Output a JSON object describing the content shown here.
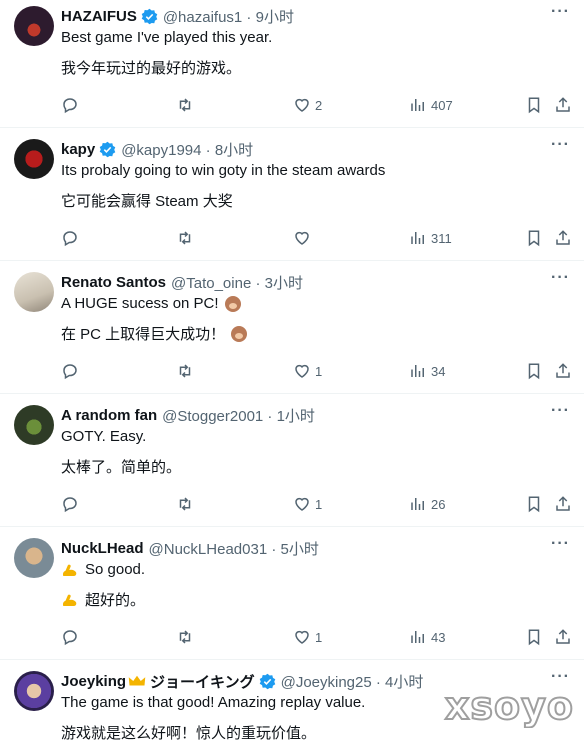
{
  "tweets": [
    {
      "name": "HAZAIFUS",
      "verified": true,
      "handle": "@hazaifus1 · 9小时",
      "text_en": "Best game I've played this year.",
      "text_zh": "我今年玩过的最好的游戏。",
      "likes": "2",
      "views": "407"
    },
    {
      "name": "kapy",
      "verified": true,
      "handle": "@kapy1994 · 8小时",
      "text_en": "Its probaly going to win goty in the steam awards",
      "text_zh": "它可能会赢得 Steam 大奖",
      "likes": "",
      "views": "311"
    },
    {
      "name": "Renato Santos",
      "verified": false,
      "handle": "@Tato_oine · 3小时",
      "text_en": "A HUGE sucess on PC!",
      "text_zh": "在 PC 上取得巨大成功！",
      "likes": "1",
      "views": "34"
    },
    {
      "name": "A random fan",
      "verified": false,
      "handle": "@Stogger2001 · 1小时",
      "text_en": "GOTY. Easy.",
      "text_zh": "太棒了。简单的。",
      "likes": "1",
      "views": "26"
    },
    {
      "name": "NuckLHead",
      "verified": false,
      "handle": "@NuckLHead031 · 5小时",
      "text_en": "So good.",
      "text_zh": "超好的。",
      "likes": "1",
      "views": "43"
    },
    {
      "name": "Joeyking",
      "name_extra": "ジョーイキング",
      "verified": true,
      "handle": "@Joeyking25 · 4小时",
      "text_en": "The game is that good! Amazing replay value.",
      "text_zh": "游戏就是这么好啊！惊人的重玩价值。",
      "likes": "",
      "views": ""
    }
  ],
  "more_label": "···",
  "watermark": "xsoyo",
  "colors": {
    "verified": "#1d9bf0",
    "muted": "#536471"
  }
}
